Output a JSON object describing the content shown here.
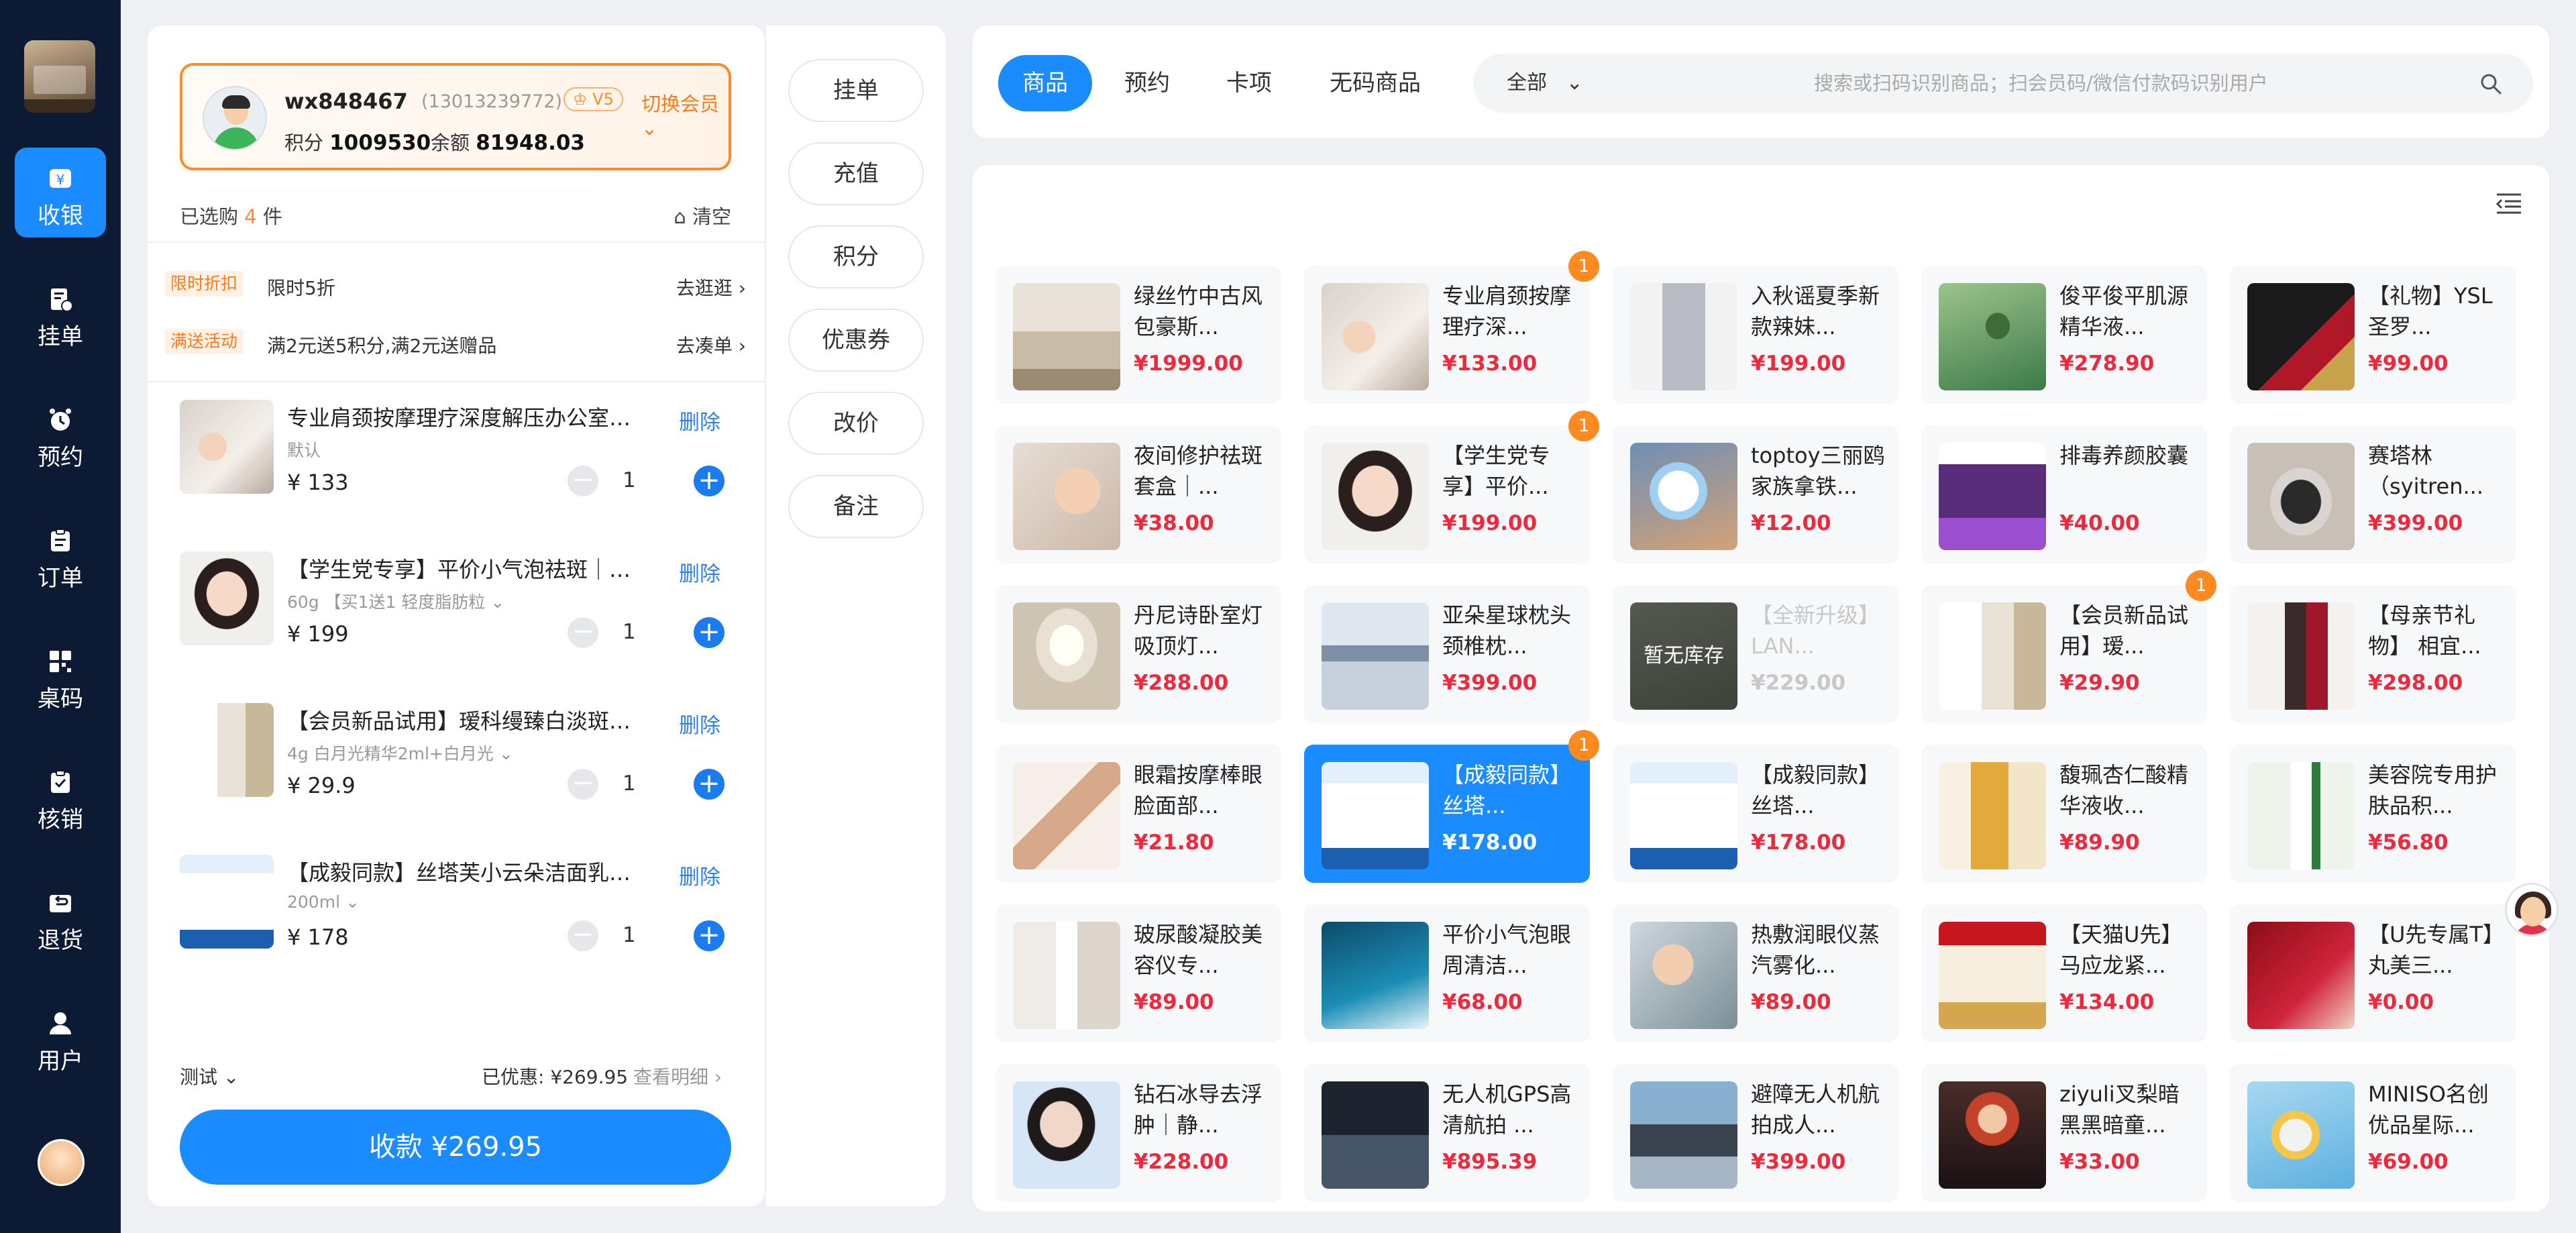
{
  "sidebar": {
    "items": [
      {
        "label": "收银",
        "icon": "cashier-icon"
      },
      {
        "label": "挂单",
        "icon": "hold-order-icon"
      },
      {
        "label": "预约",
        "icon": "clock-icon"
      },
      {
        "label": "订单",
        "icon": "order-icon"
      },
      {
        "label": "桌码",
        "icon": "qr-icon"
      },
      {
        "label": "核销",
        "icon": "verify-icon"
      },
      {
        "label": "退货",
        "icon": "return-icon"
      },
      {
        "label": "用户",
        "icon": "user-icon"
      }
    ]
  },
  "member": {
    "name": "wx848467",
    "phone": "(13013239772)",
    "level": "V5",
    "switch_label": "切换会员",
    "points_label": "积分",
    "points": "1009530",
    "balance_label": "余额",
    "balance": "81948.03"
  },
  "cart": {
    "selected_prefix": "已选购",
    "selected_count": "4",
    "selected_suffix": "件",
    "clear_label": "清空",
    "promos": [
      {
        "tag": "限时折扣",
        "text": "限时5折",
        "link": "去逛逛"
      },
      {
        "tag": "满送活动",
        "text": "满2元送5积分,满2元送赠品",
        "link": "去凑单"
      }
    ],
    "delete_label": "删除",
    "items": [
      {
        "title": "专业肩颈按摩理疗深度解压办公室久坐疲劳",
        "spec": "默认",
        "price": "¥ 133",
        "qty": "1"
      },
      {
        "title": "【学生党专享】平价小气泡祛斑｜淡斑精华",
        "spec": "60g 【买1送1 轻度脂肪粒",
        "price": "¥ 199",
        "qty": "1"
      },
      {
        "title": "【会员新品试用】瑷科缦臻白淡斑精华套装",
        "spec": "4g 白月光精华2ml+白月光",
        "price": "¥ 29.9",
        "qty": "1"
      },
      {
        "title": "【成毅同款】丝塔芙小云朵洁面乳温和清洁",
        "spec": "200ml",
        "price": "¥ 178",
        "qty": "1"
      }
    ],
    "staff": "测试",
    "discount": "已优惠: ¥269.95",
    "detail": "查看明细",
    "pay_label": "收款 ¥269.95"
  },
  "actions": [
    "挂单",
    "充值",
    "积分",
    "优惠券",
    "改价",
    "备注"
  ],
  "tabs": [
    {
      "label": "商品",
      "active": true
    },
    {
      "label": "预约",
      "active": false
    },
    {
      "label": "卡项",
      "active": false
    },
    {
      "label": "无码商品",
      "active": false
    }
  ],
  "search": {
    "category": "全部",
    "placeholder": "搜索或扫码识别商品；扫会员码/微信付款码识别用户"
  },
  "products": [
    {
      "name": "绿丝竹中古风包豪斯...",
      "price": "¥1999.00",
      "img": "sofa"
    },
    {
      "name": "专业肩颈按摩理疗深...",
      "price": "¥133.00",
      "img": "massage",
      "badge": "1"
    },
    {
      "name": "入秋谣夏季新款辣妹...",
      "price": "¥199.00",
      "img": "dress"
    },
    {
      "name": "俊平俊平肌源精华液...",
      "price": "¥278.90",
      "img": "serum-green"
    },
    {
      "name": "【礼物】YSL圣罗...",
      "price": "¥99.00",
      "img": "ysl"
    },
    {
      "name": "夜间修护祛斑套盒｜...",
      "price": "¥38.00",
      "img": "facial"
    },
    {
      "name": "【学生党专享】平价...",
      "price": "¥199.00",
      "img": "face-model",
      "badge": "1"
    },
    {
      "name": "toptoy三丽鸥家族拿铁...",
      "price": "¥12.00",
      "img": "toy"
    },
    {
      "name": "排毒养颜胶囊",
      "price": "¥40.00",
      "img": "capsule"
    },
    {
      "name": "赛塔林（syitren...",
      "price": "¥399.00",
      "img": "device"
    },
    {
      "name": "丹尼诗卧室灯吸顶灯...",
      "price": "¥288.00",
      "img": "lamp"
    },
    {
      "name": "亚朵星球枕头颈椎枕...",
      "price": "¥399.00",
      "img": "pillow"
    },
    {
      "name": "【全新升级】LAN...",
      "price": "¥229.00",
      "img": "lan",
      "out": "暂无库存"
    },
    {
      "name": "【会员新品试用】瑷...",
      "price": "¥29.90",
      "img": "cream",
      "badge": "1"
    },
    {
      "name": "【母亲节礼物】 相宜...",
      "price": "¥298.00",
      "img": "gift"
    },
    {
      "name": "眼霜按摩棒眼脸面部...",
      "price": "¥21.80",
      "img": "roller"
    },
    {
      "name": "【成毅同款】丝塔...",
      "price": "¥178.00",
      "img": "cetaphil",
      "badge": "1",
      "selected": true
    },
    {
      "name": "【成毅同款】丝塔...",
      "price": "¥178.00",
      "img": "cetaphil"
    },
    {
      "name": "馥珮杏仁酸精华液收...",
      "price": "¥89.90",
      "img": "serum-gold"
    },
    {
      "name": "美容院专用护肤品积...",
      "price": "¥56.80",
      "img": "bottle-green"
    },
    {
      "name": "玻尿酸凝胶美容仪专...",
      "price": "¥89.00",
      "img": "gel"
    },
    {
      "name": "平价小气泡眼周清洁...",
      "price": "¥68.00",
      "img": "hcein"
    },
    {
      "name": "热敷润眼仪蒸汽雾化...",
      "price": "¥89.00",
      "img": "steam"
    },
    {
      "name": "【天猫U先】马应龙紧...",
      "price": "¥134.00",
      "img": "mayinglong"
    },
    {
      "name": "【U先专属T】丸美三...",
      "price": "¥0.00",
      "img": "red-set"
    },
    {
      "name": "钻石冰导去浮肿｜静...",
      "price": "¥228.00",
      "img": "ice"
    },
    {
      "name": "无人机GPS高清航拍 ...",
      "price": "¥895.39",
      "img": "drone"
    },
    {
      "name": "避障无人机航拍成人...",
      "price": "¥399.00",
      "img": "drone2"
    },
    {
      "name": "ziyuli叉梨暗黑黑暗童...",
      "price": "¥33.00",
      "img": "figure"
    },
    {
      "name": "MINISO名创优品星际...",
      "price": "¥69.00",
      "img": "miniso"
    }
  ]
}
